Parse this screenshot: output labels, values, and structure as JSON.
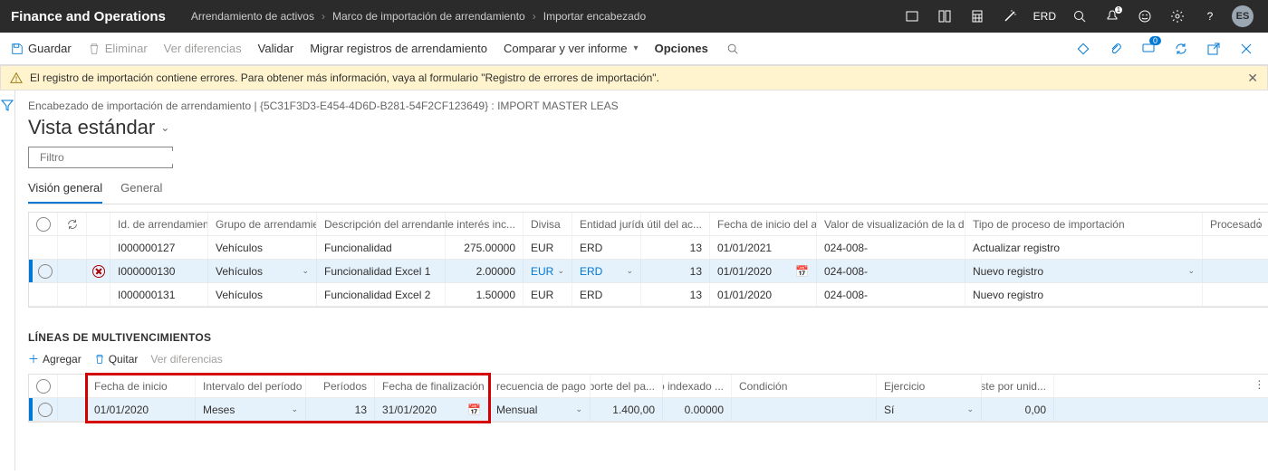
{
  "brand": "Finance and Operations",
  "breadcrumbs": [
    "Arrendamiento de activos",
    "Marco de importación de arrendamiento",
    "Importar encabezado"
  ],
  "topright": {
    "erd": "ERD",
    "avatar": "ES"
  },
  "actionbar": {
    "save": "Guardar",
    "delete": "Eliminar",
    "diff": "Ver diferencias",
    "validate": "Validar",
    "migrate": "Migrar registros de arrendamiento",
    "compare": "Comparar y ver informe",
    "options": "Opciones",
    "badge0": "0"
  },
  "warning": "El registro de importación contiene errores. Para obtener más información, vaya al formulario \"Registro de errores de importación\".",
  "header": {
    "crumbline": "Encabezado de importación de arrendamiento   |   {5C31F3D3-E454-4D6D-B281-54F2CF123649} : IMPORT MASTER LEAS",
    "view": "Vista estándar",
    "filter_placeholder": "Filtro"
  },
  "tabs": {
    "overview": "Visión general",
    "general": "General"
  },
  "grid1": {
    "cols": {
      "lease": "Id. de arrendamiento",
      "group": "Grupo de arrendamiento",
      "desc": "Descripción del arrendamiento",
      "rate": "Tipo de interés inc...",
      "curr": "Divisa",
      "legal": "Entidad jurídica",
      "life": "Vida útil del ac...",
      "start": "Fecha de inicio del arrend...",
      "dimdisp": "Valor de visualización de la dimensi...",
      "proc": "Tipo de proceso de importación",
      "done": "Procesado"
    },
    "rows": [
      {
        "lease": "I000000127",
        "group": "Vehículos",
        "desc": "Funcionalidad",
        "rate": "275.00000",
        "curr": "EUR",
        "legal": "ERD",
        "life": "13",
        "start": "01/01/2021",
        "dimdisp": "024-008-",
        "proc": "Actualizar registro",
        "selected": false,
        "error": false
      },
      {
        "lease": "I000000130",
        "group": "Vehículos",
        "desc": "Funcionalidad Excel 1",
        "rate": "2.00000",
        "curr": "EUR",
        "legal": "ERD",
        "life": "13",
        "start": "01/01/2020",
        "dimdisp": "024-008-",
        "proc": "Nuevo registro",
        "selected": true,
        "error": true
      },
      {
        "lease": "I000000131",
        "group": "Vehículos",
        "desc": "Funcionalidad Excel 2",
        "rate": "1.50000",
        "curr": "EUR",
        "legal": "ERD",
        "life": "13",
        "start": "01/01/2020",
        "dimdisp": "024-008-",
        "proc": "Nuevo registro",
        "selected": false,
        "error": false
      }
    ]
  },
  "section2": {
    "title": "LÍNEAS DE MULTIVENCIMIENTOS",
    "add": "Agregar",
    "remove": "Quitar",
    "diff": "Ver diferencias"
  },
  "grid2": {
    "cols": {
      "start": "Fecha de inicio",
      "interval": "Intervalo del período",
      "periods": "Períodos",
      "end": "Fecha de finalización",
      "freq": "recuencia de pago",
      "amt": "Importe del pa...",
      "idx": "Tipo indexado ...",
      "cond": "Condición",
      "exer": "Ejercicio",
      "cost": "Coste por unid..."
    },
    "row": {
      "start": "01/01/2020",
      "interval": "Meses",
      "periods": "13",
      "end": "31/01/2020",
      "freq": "Mensual",
      "amt": "1.400,00",
      "idx": "0.00000",
      "cond": "",
      "exer": "Sí",
      "cost": "0,00"
    }
  }
}
